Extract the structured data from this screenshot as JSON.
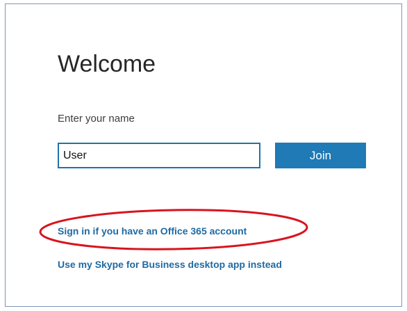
{
  "welcome": {
    "title": "Welcome",
    "name_label": "Enter your name",
    "name_input_value": "User",
    "join_button_label": "Join"
  },
  "links": {
    "sign_in_label": "Sign in if you have an Office 365 account",
    "desktop_app_label": "Use my Skype for Business desktop app instead"
  },
  "colors": {
    "accent": "#1f7ab5",
    "link": "#1f6aa2",
    "highlight": "#d8141e"
  }
}
